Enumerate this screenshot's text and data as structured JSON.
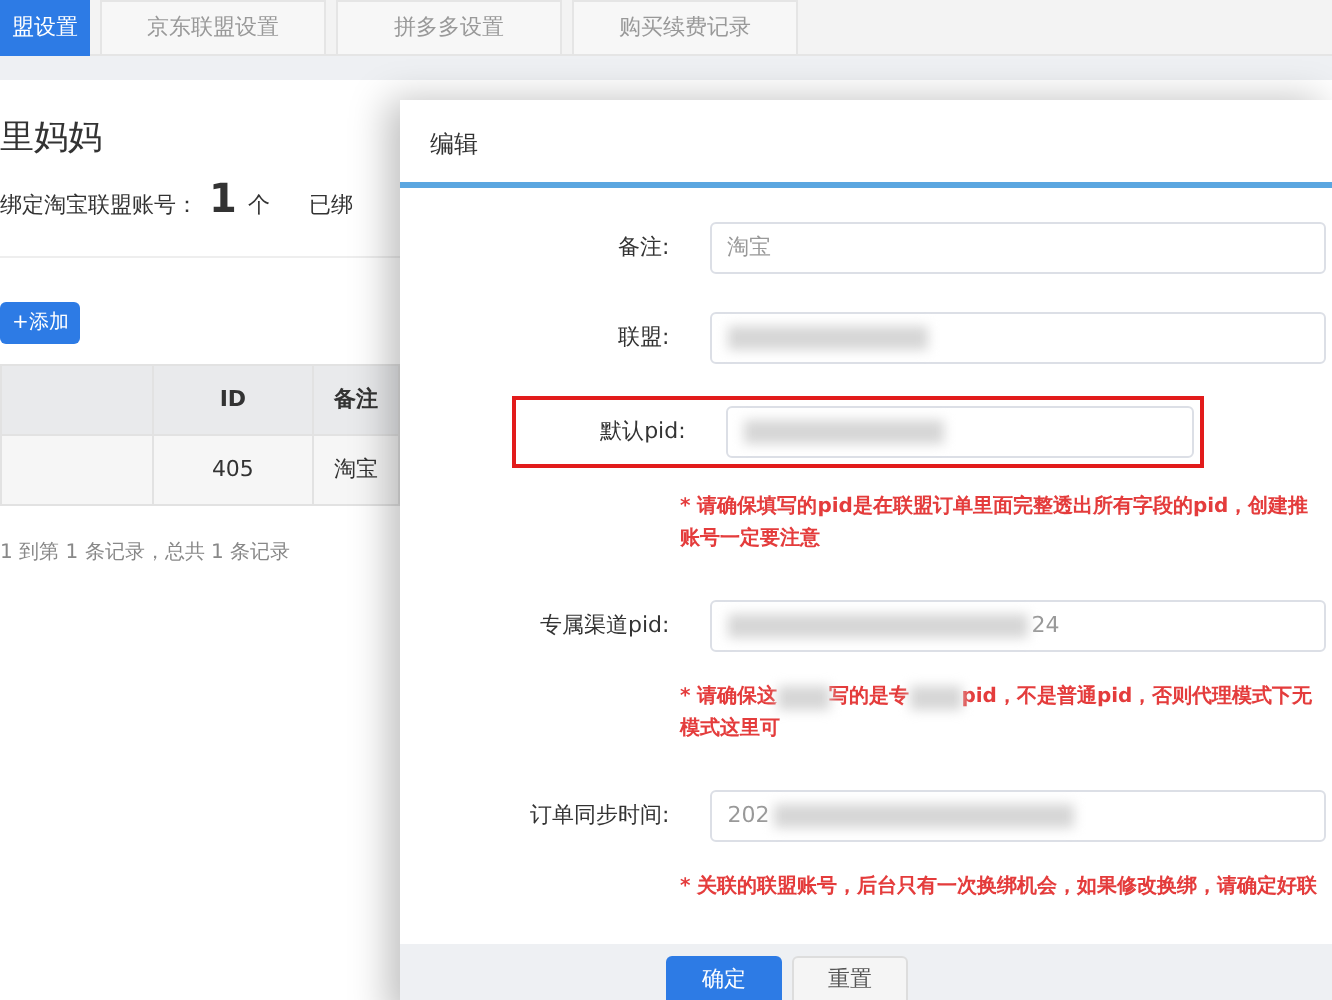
{
  "tabs": [
    {
      "label": "盟设置",
      "selected": true
    },
    {
      "label": "京东联盟设置",
      "selected": false
    },
    {
      "label": "拼多多设置",
      "selected": false
    },
    {
      "label": "购买续费记录",
      "selected": false
    }
  ],
  "page": {
    "title": "里妈妈",
    "bind_label": "绑定淘宝联盟账号：",
    "bind_count": "1",
    "bind_unit": "个",
    "bound_label": "已绑",
    "add_button": "+添加"
  },
  "table": {
    "columns": [
      "",
      "ID",
      "备注",
      ""
    ],
    "rows": [
      [
        "",
        "405",
        "淘宝",
        ""
      ]
    ],
    "footer": "1 到第 1 条记录，总共 1 条记录"
  },
  "dialog": {
    "title": "编辑",
    "fields": [
      {
        "label": "备注:",
        "value": "淘宝",
        "redacted": false,
        "highlighted": false
      },
      {
        "label": "联盟:",
        "redacted": true,
        "highlighted": false
      },
      {
        "label": "默认pid:",
        "redacted": true,
        "highlighted": true,
        "hint": [
          [
            "* 请确保填写的pid是在联盟订单里面完整透出所有字段的pid，创建推"
          ],
          [
            "账号一定要注意"
          ]
        ]
      },
      {
        "label": "专属渠道pid:",
        "value": "24",
        "redacted": true,
        "highlighted": false,
        "hint": [
          [
            "* 请确保这",
            "写的是专",
            "pid，不是普通pid，否则代理模式下无"
          ],
          [
            "模式这里可"
          ]
        ]
      },
      {
        "label": "订单同步时间:",
        "value": "202",
        "redacted": true,
        "highlighted": false,
        "hint": [
          [
            "* 关联的联盟账号，后台只有一次换绑机会，如果修改换绑，请确定好联"
          ]
        ]
      }
    ],
    "buttons": [
      {
        "label": "确定",
        "kind": "primary"
      },
      {
        "label": "重置",
        "kind": "secondary"
      }
    ]
  }
}
